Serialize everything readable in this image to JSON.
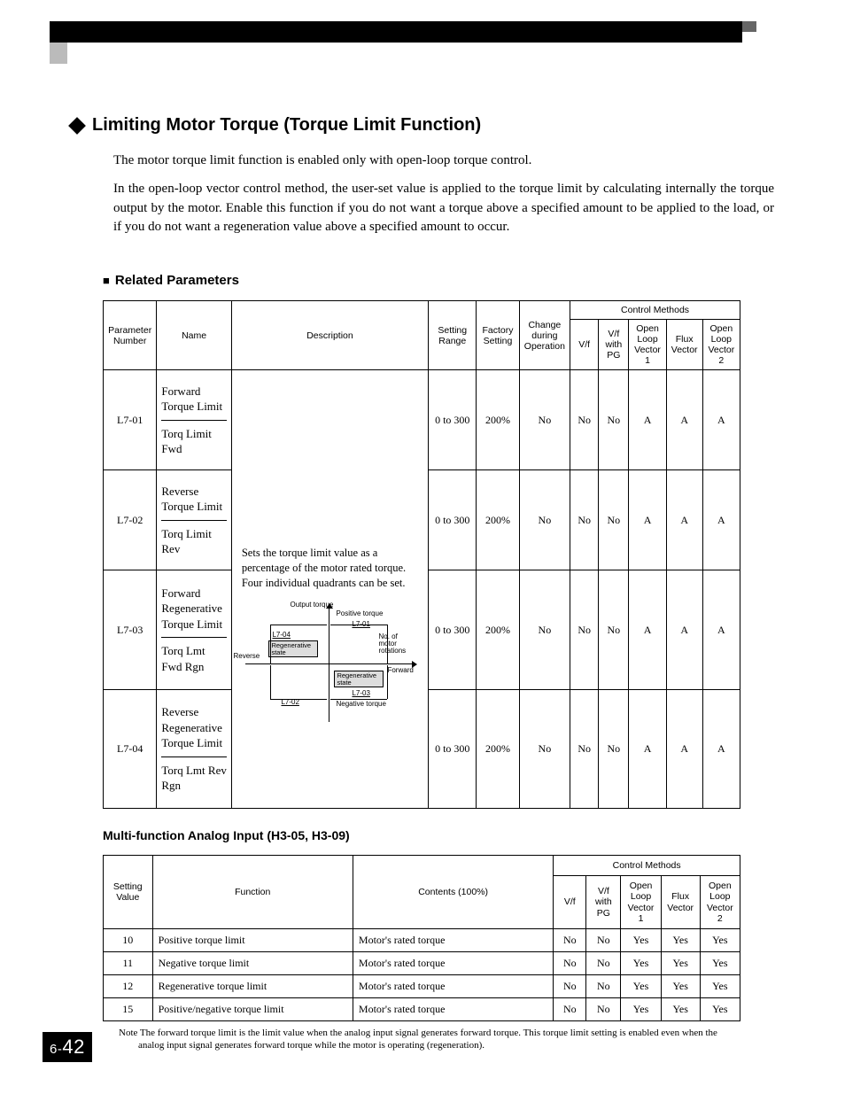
{
  "page": {
    "chapter_prefix": "6-",
    "page_number": "42"
  },
  "section": {
    "title": "Limiting Motor Torque (Torque Limit Function)",
    "para1": "The motor torque limit function is enabled only with open-loop torque control.",
    "para2": "In the open-loop vector control method, the user-set value is applied to the torque limit by calculating internally the torque output by the motor. Enable this function if you do not want a torque above a specified amount to be applied to the load, or if you do not want a regeneration value above a specified amount to occur.",
    "related_heading": "Related Parameters"
  },
  "param_table": {
    "headers": {
      "param_no": "Parameter Number",
      "name": "Name",
      "description": "Description",
      "setting_range": "Setting Range",
      "factory": "Factory Setting",
      "change": "Change during Operation",
      "control_methods": "Control Methods",
      "cm": [
        "V/f",
        "V/f with PG",
        "Open Loop Vector 1",
        "Flux Vector",
        "Open Loop Vector 2"
      ]
    },
    "description_text": "Sets the torque limit value as a percentage of the motor rated torque. Four individual quadrants can be set.",
    "diagram": {
      "output_torque": "Output torque",
      "positive_torque": "Positive torque",
      "negative_torque": "Negative torque",
      "reverse": "Reverse",
      "forward": "Forward",
      "no_of_rotations": "No. of motor rotations",
      "l7_01": "L7-01",
      "l7_02": "L7-02",
      "l7_03": "L7-03",
      "l7_04": "L7-04",
      "regen": "Regenerative state"
    },
    "rows": [
      {
        "no": "L7-01",
        "name_main": "Forward Torque Limit",
        "name_sub": "Torq Limit Fwd",
        "range": "0 to 300",
        "factory": "200%",
        "change": "No",
        "cm": [
          "No",
          "No",
          "A",
          "A",
          "A"
        ]
      },
      {
        "no": "L7-02",
        "name_main": "Reverse Torque Limit",
        "name_sub": "Torq Limit Rev",
        "range": "0 to 300",
        "factory": "200%",
        "change": "No",
        "cm": [
          "No",
          "No",
          "A",
          "A",
          "A"
        ]
      },
      {
        "no": "L7-03",
        "name_main": "Forward Regenerative Torque Limit",
        "name_sub": "Torq Lmt Fwd Rgn",
        "range": "0 to 300",
        "factory": "200%",
        "change": "No",
        "cm": [
          "No",
          "No",
          "A",
          "A",
          "A"
        ]
      },
      {
        "no": "L7-04",
        "name_main": "Reverse Regenerative Torque Limit",
        "name_sub": "Torq Lmt Rev Rgn",
        "range": "0 to 300",
        "factory": "200%",
        "change": "No",
        "cm": [
          "No",
          "No",
          "A",
          "A",
          "A"
        ]
      }
    ]
  },
  "mf_heading": "Multi-function Analog Input (H3-05, H3-09)",
  "mf_table": {
    "headers": {
      "setting_value": "Setting Value",
      "function": "Function",
      "contents": "Contents (100%)",
      "control_methods": "Control Methods",
      "cm": [
        "V/f",
        "V/f with PG",
        "Open Loop Vector 1",
        "Flux Vector",
        "Open Loop Vector 2"
      ]
    },
    "rows": [
      {
        "val": "10",
        "func": "Positive torque limit",
        "contents": "Motor's rated torque",
        "cm": [
          "No",
          "No",
          "Yes",
          "Yes",
          "Yes"
        ]
      },
      {
        "val": "11",
        "func": "Negative torque limit",
        "contents": "Motor's rated torque",
        "cm": [
          "No",
          "No",
          "Yes",
          "Yes",
          "Yes"
        ]
      },
      {
        "val": "12",
        "func": "Regenerative torque limit",
        "contents": "Motor's rated torque",
        "cm": [
          "No",
          "No",
          "Yes",
          "Yes",
          "Yes"
        ]
      },
      {
        "val": "15",
        "func": "Positive/negative torque limit",
        "contents": "Motor's rated torque",
        "cm": [
          "No",
          "No",
          "Yes",
          "Yes",
          "Yes"
        ]
      }
    ]
  },
  "note": "Note  The forward torque limit is the limit value when the analog input signal generates forward torque. This torque limit setting is enabled even when the analog input signal generates forward torque while the motor is operating (regeneration)."
}
